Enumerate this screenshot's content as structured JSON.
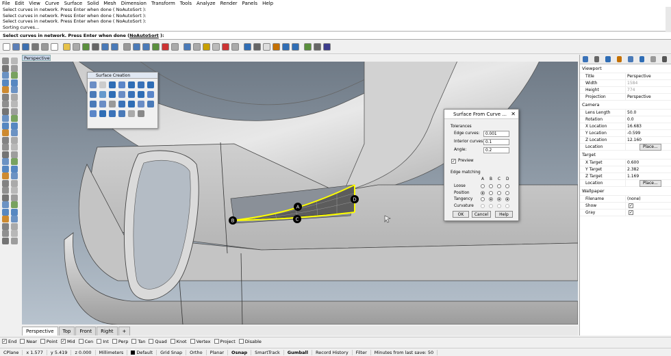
{
  "menu": [
    "File",
    "Edit",
    "View",
    "Curve",
    "Surface",
    "Solid",
    "Mesh",
    "Dimension",
    "Transform",
    "Tools",
    "Analyze",
    "Render",
    "Panels",
    "Help"
  ],
  "history": [
    "Select curves in network. Press Enter when done ( NoAutoSort ):",
    "Select curves in network. Press Enter when done ( NoAutoSort ):",
    "Select curves in network. Press Enter when done ( NoAutoSort ):",
    "Sorting curves..."
  ],
  "command": {
    "prompt": "Select curves in network. Press Enter when done (",
    "option": "NoAutoSort",
    "suffix": " ):"
  },
  "viewport": {
    "title": "Perspective"
  },
  "surface_creation": {
    "title": "Surface Creation"
  },
  "dialog": {
    "title": "Surface From Curve ...",
    "close": "✕",
    "tolerances_label": "Tolerances",
    "edge_curves_label": "Edge curves:",
    "edge_curves_value": "0.001",
    "interior_curves_label": "Interior curves:",
    "interior_curves_value": "0.1",
    "angle_label": "Angle:",
    "angle_value": "0.2",
    "preview_label": "Preview",
    "edge_matching_label": "Edge matching",
    "cols": [
      "A",
      "B",
      "C",
      "D"
    ],
    "rows": [
      "Loose",
      "Position",
      "Tangency",
      "Curvature"
    ],
    "ok": "OK",
    "cancel": "Cancel",
    "help": "Help"
  },
  "curve_labels": [
    "A",
    "B",
    "C",
    "D"
  ],
  "view_tabs": [
    "Perspective",
    "Top",
    "Front",
    "Right"
  ],
  "add_tab": "+",
  "osnap": [
    {
      "label": "End",
      "checked": true
    },
    {
      "label": "Near",
      "checked": false
    },
    {
      "label": "Point",
      "checked": false
    },
    {
      "label": "Mid",
      "checked": true
    },
    {
      "label": "Cen",
      "checked": false
    },
    {
      "label": "Int",
      "checked": false
    },
    {
      "label": "Perp",
      "checked": false
    },
    {
      "label": "Tan",
      "checked": false
    },
    {
      "label": "Quad",
      "checked": false
    },
    {
      "label": "Knot",
      "checked": false
    },
    {
      "label": "Vertex",
      "checked": false
    },
    {
      "label": "Project",
      "checked": false
    },
    {
      "label": "Disable",
      "checked": false
    }
  ],
  "status": {
    "cplane": "CPlane",
    "x": "x 1.577",
    "y": "y 5.419",
    "z": "z 0.000",
    "units": "Millimeters",
    "layer": "Default",
    "items": [
      "Grid Snap",
      "Ortho",
      "Planar",
      "Osnap",
      "SmartTrack",
      "Gumball",
      "Record History",
      "Filter"
    ],
    "bold_items": [
      "Osnap",
      "Gumball"
    ],
    "save": "Minutes from last save: 50"
  },
  "panel": {
    "viewport_section": "Viewport",
    "viewport_rows": [
      {
        "k": "Title",
        "v": "Perspective",
        "gray": false
      },
      {
        "k": "Width",
        "v": "1584",
        "gray": true
      },
      {
        "k": "Height",
        "v": "774",
        "gray": true
      },
      {
        "k": "Projection",
        "v": "Perspective",
        "gray": false
      }
    ],
    "camera_section": "Camera",
    "camera_rows": [
      {
        "k": "Lens Length",
        "v": "50.0"
      },
      {
        "k": "Rotation",
        "v": "0.0"
      },
      {
        "k": "X Location",
        "v": "16.683"
      },
      {
        "k": "Y Location",
        "v": "-0.599"
      },
      {
        "k": "Z Location",
        "v": "12.160"
      }
    ],
    "location_label": "Location",
    "place_button": "Place...",
    "target_section": "Target",
    "target_rows": [
      {
        "k": "X Target",
        "v": "0.600"
      },
      {
        "k": "Y Target",
        "v": "2.382"
      },
      {
        "k": "Z Target",
        "v": "1.169"
      }
    ],
    "wallpaper_section": "Wallpaper",
    "filename_label": "Filename",
    "filename_value": "(none)",
    "show_label": "Show",
    "gray_label": "Gray"
  }
}
